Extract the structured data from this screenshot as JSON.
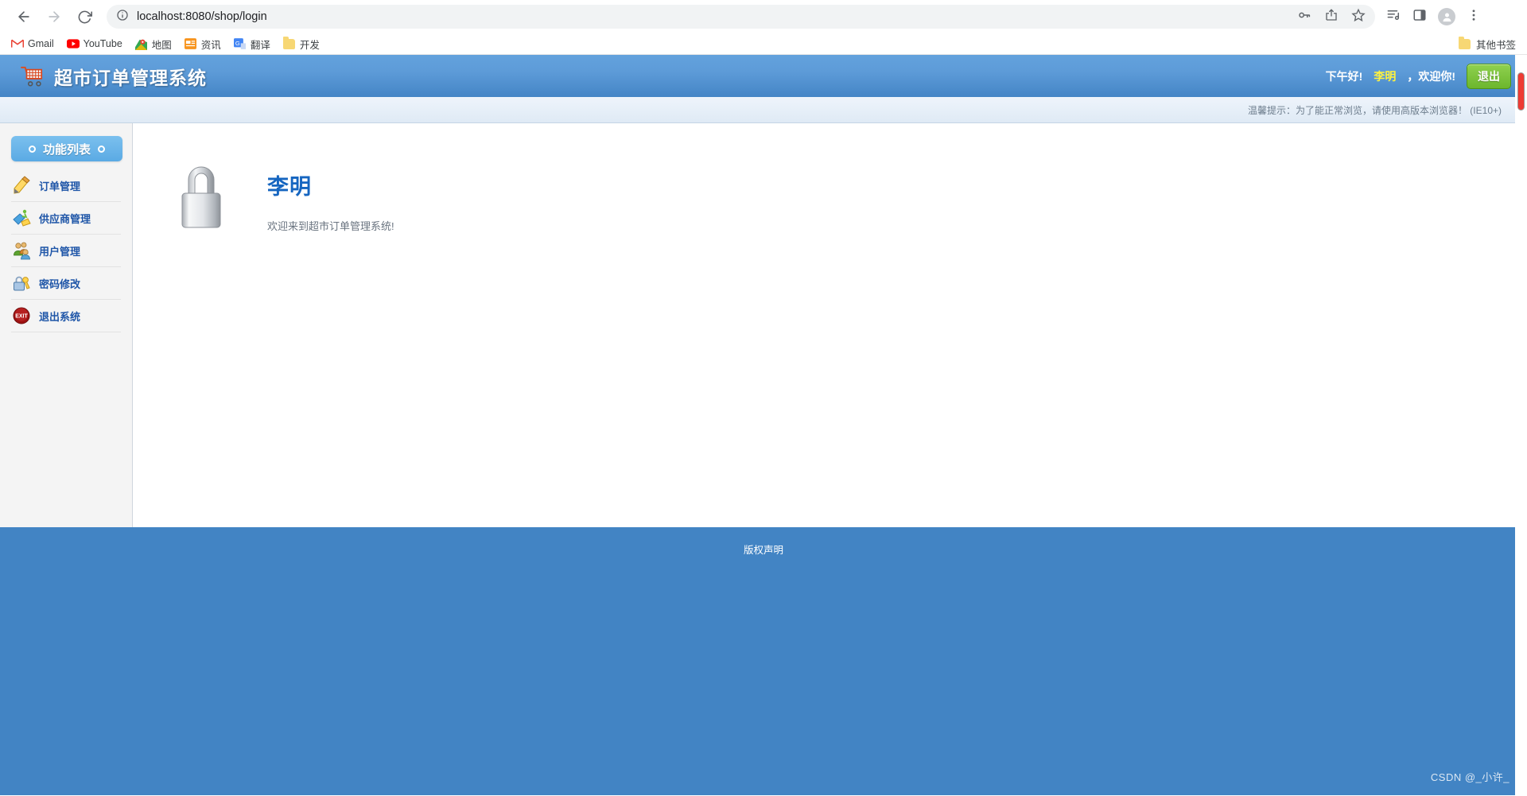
{
  "browser": {
    "back_label": "back-arrow",
    "forward_label": "forward-arrow",
    "reload_label": "reload",
    "url_host": "localhost:8080",
    "url_path": "/shop/login",
    "url_full": "localhost:8080/shop/login",
    "toolbar_icons": [
      "key-icon",
      "share-icon",
      "star-icon",
      "reading-list-icon",
      "side-panel-icon",
      "profile-icon",
      "menu-icon"
    ],
    "bookmarks": [
      {
        "label": "Gmail",
        "icon": "gmail-icon"
      },
      {
        "label": "YouTube",
        "icon": "youtube-icon"
      },
      {
        "label": "地图",
        "icon": "maps-icon"
      },
      {
        "label": "资讯",
        "icon": "news-icon"
      },
      {
        "label": "翻译",
        "icon": "translate-icon"
      },
      {
        "label": "开发",
        "icon": "folder-icon"
      }
    ],
    "other_bookmarks": "其他书签"
  },
  "app": {
    "title": "超市订单管理系统",
    "logo_icon": "shopping-cart-icon",
    "greeting": "下午好!",
    "username": "李明",
    "welcome_tail": "，欢迎你!",
    "logout_label": "退出",
    "tip": "温馨提示：为了能正常浏览，请使用高版本浏览器！  (IE10+)"
  },
  "sidebar": {
    "panel_title": "功能列表",
    "items": [
      {
        "label": "订单管理",
        "icon": "order-pencil-icon"
      },
      {
        "label": "供应商管理",
        "icon": "supplier-icon"
      },
      {
        "label": "用户管理",
        "icon": "users-icon"
      },
      {
        "label": "密码修改",
        "icon": "lock-key-icon"
      },
      {
        "label": "退出系统",
        "icon": "exit-icon"
      }
    ]
  },
  "main": {
    "lock_icon": "padlock-icon",
    "user_name": "李明",
    "welcome_message": "欢迎来到超市订单管理系统!"
  },
  "footer": {
    "copyright": "版权声明",
    "watermark": "CSDN @_小许_"
  },
  "colors": {
    "header_blue": "#5d9bd8",
    "footer_blue": "#4284c4",
    "accent_yellow": "#fff23f",
    "logout_green": "#6cb62d",
    "link_blue": "#1f56a8",
    "scrollbar_red": "#ee3b33"
  }
}
